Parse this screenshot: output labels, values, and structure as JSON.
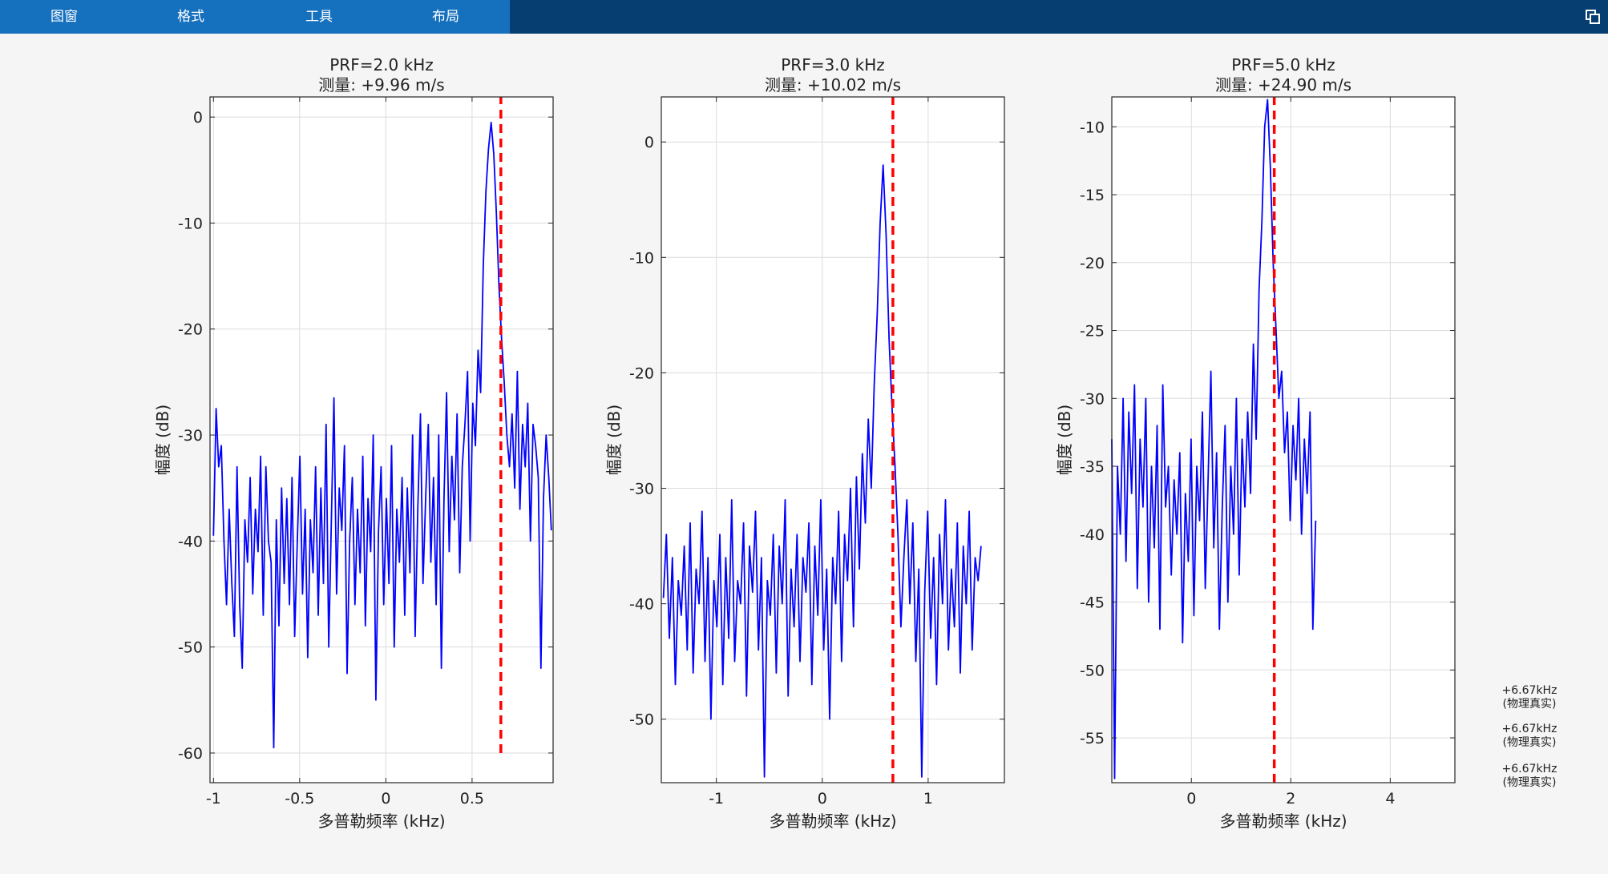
{
  "menu": {
    "tabs": [
      {
        "label": "图窗"
      },
      {
        "label": "格式"
      },
      {
        "label": "工具"
      },
      {
        "label": "布局"
      }
    ],
    "icon": "undock-icon"
  },
  "side_notes": [
    {
      "line1": "+6.67kHz",
      "line2": "(物理真实)"
    },
    {
      "line1": "+6.67kHz",
      "line2": "(物理真实)"
    },
    {
      "line1": "+6.67kHz",
      "line2": "(物理真实)"
    }
  ],
  "colors": {
    "spectrum": "#0000ff",
    "true_line": "#ff0000",
    "menubar": "#063e72",
    "tabbar": "#1570be"
  },
  "chart_data": [
    {
      "type": "line",
      "title_line1": "PRF=2.0 kHz",
      "title_line2": "测量:  +9.96 m/s",
      "xlabel": "多普勒频率 (kHz)",
      "ylabel": "幅度 (dB)",
      "xlim": [
        -1.02,
        0.97
      ],
      "ylim": [
        -62.8,
        1.9
      ],
      "xticks": [
        -1,
        -0.5,
        0,
        0.5
      ],
      "xtick_labels": [
        "-1",
        "-0.5",
        "0",
        "0.5"
      ],
      "yticks": [
        -60,
        -50,
        -40,
        -30,
        -20,
        -10,
        0
      ],
      "ytick_labels": [
        "-60",
        "-50",
        "-40",
        "-30",
        "-20",
        "-10",
        "0"
      ],
      "grid": true,
      "peak_x": 0.667,
      "x_start": -1.0,
      "x_end": 0.96,
      "vline": {
        "x": 0.667,
        "y_from": -60.0,
        "y_to": 1.9,
        "style": "dashed"
      },
      "series": [
        {
          "values": [
            -39.5,
            -27.5,
            -33,
            -31,
            -40,
            -46,
            -37,
            -44,
            -49,
            -33,
            -46,
            -52,
            -38,
            -42,
            -34,
            -45,
            -37,
            -41,
            -32,
            -47,
            -33,
            -40,
            -42,
            -59.5,
            -38,
            -48,
            -35,
            -44,
            -36,
            -46,
            -34,
            -49,
            -40,
            -32,
            -45,
            -37,
            -51,
            -38,
            -43,
            -33,
            -47,
            -35,
            -44,
            -29,
            -50,
            -38,
            -26.5,
            -45,
            -35,
            -39,
            -31,
            -52.5,
            -40,
            -34,
            -46,
            -37,
            -43,
            -32,
            -48,
            -36,
            -41,
            -30,
            -55,
            -39,
            -33,
            -46,
            -36,
            -44,
            -31,
            -50,
            -37,
            -42,
            -34,
            -47,
            -35,
            -43,
            -30,
            -49,
            -37,
            -28,
            -44,
            -36,
            -29,
            -42,
            -34,
            -46,
            -30,
            -52,
            -36,
            -26,
            -41,
            -32,
            -38,
            -28,
            -43,
            -33,
            -29,
            -24,
            -40,
            -27,
            -31,
            -22,
            -26,
            -14,
            -7,
            -3,
            -0.5,
            -3.5,
            -9,
            -16,
            -21,
            -25,
            -30,
            -33,
            -28,
            -35,
            -24,
            -37,
            -29,
            -33,
            -27,
            -40,
            -29,
            -31,
            -34,
            -52,
            -36,
            -30,
            -34,
            -39
          ]
        }
      ]
    },
    {
      "type": "line",
      "title_line1": "PRF=3.0 kHz",
      "title_line2": "测量: +10.02 m/s",
      "xlabel": "多普勒频率 (kHz)",
      "ylabel": "幅度 (dB)",
      "xlim": [
        -1.52,
        1.72
      ],
      "ylim": [
        -55.5,
        3.9
      ],
      "xticks": [
        -1,
        0,
        1
      ],
      "xtick_labels": [
        "-1",
        "0",
        "1"
      ],
      "yticks": [
        -50,
        -40,
        -30,
        -20,
        -10,
        0
      ],
      "ytick_labels": [
        "-50",
        "-40",
        "-30",
        "-20",
        "-10",
        "0"
      ],
      "grid": true,
      "peak_x": 0.667,
      "x_start": -1.5,
      "x_end": 1.5,
      "vline": {
        "x": 0.667,
        "y_from": -55.5,
        "y_to": 3.9,
        "style": "dashed"
      },
      "series": [
        {
          "values": [
            -39.5,
            -34,
            -43,
            -36,
            -47,
            -38,
            -41,
            -35,
            -44,
            -33,
            -46,
            -37,
            -40,
            -32,
            -45,
            -36,
            -50,
            -38,
            -42,
            -34,
            -47,
            -36,
            -43,
            -31,
            -45,
            -38,
            -40,
            -33,
            -48,
            -35,
            -39,
            -32,
            -44,
            -36,
            -55,
            -38,
            -41,
            -34,
            -46,
            -35,
            -40,
            -31,
            -48,
            -37,
            -42,
            -34,
            -45,
            -36,
            -39,
            -33,
            -47,
            -35,
            -41,
            -31,
            -44,
            -37,
            -50,
            -36,
            -40,
            -32,
            -45,
            -34,
            -38,
            -30,
            -42,
            -29,
            -37,
            -27,
            -33,
            -24,
            -30,
            -21,
            -15,
            -7,
            -2,
            -8,
            -17,
            -23,
            -28,
            -34,
            -42,
            -36,
            -31,
            -40,
            -33,
            -45,
            -37,
            -55,
            -39,
            -32,
            -43,
            -36,
            -47,
            -34,
            -40,
            -31,
            -44,
            -37,
            -42,
            -33,
            -46,
            -35,
            -40,
            -32,
            -44,
            -36,
            -38,
            -35
          ]
        }
      ]
    },
    {
      "type": "line",
      "title_line1": "PRF=5.0 kHz",
      "title_line2": "测量: +24.90 m/s",
      "xlabel": "多普勒频率 (kHz)",
      "ylabel": "幅度 (dB)",
      "xlim": [
        -1.6,
        5.3
      ],
      "ylim": [
        -58.3,
        -7.8
      ],
      "xticks": [
        0,
        2,
        4
      ],
      "xtick_labels": [
        "0",
        "2",
        "4"
      ],
      "yticks": [
        -55,
        -50,
        -45,
        -40,
        -35,
        -30,
        -25,
        -20,
        -15,
        -10
      ],
      "ytick_labels": [
        "-55",
        "-50",
        "-45",
        "-40",
        "-35",
        "-30",
        "-25",
        "-20",
        "-15",
        "-10"
      ],
      "grid": true,
      "peak_x": 1.667,
      "x_start": -1.6,
      "x_end": 2.5,
      "vline": {
        "x": 1.667,
        "y_from": -58.3,
        "y_to": -7.8,
        "style": "dashed"
      },
      "series": [
        {
          "values": [
            -33,
            -58,
            -35,
            -40,
            -30,
            -42,
            -31,
            -37,
            -29,
            -44,
            -33,
            -38,
            -30,
            -45,
            -35,
            -41,
            -32,
            -47,
            -29,
            -38,
            -35,
            -43,
            -36,
            -40,
            -34,
            -48,
            -37,
            -42,
            -33,
            -46,
            -35,
            -39,
            -31,
            -44,
            -36,
            -28,
            -41,
            -34,
            -47,
            -38,
            -32,
            -45,
            -35,
            -40,
            -30,
            -43,
            -33,
            -38,
            -31,
            -37,
            -26,
            -33,
            -22,
            -17,
            -10,
            -8,
            -13,
            -20,
            -25,
            -30,
            -28,
            -34,
            -31,
            -39,
            -32,
            -36,
            -30,
            -40,
            -33,
            -37,
            -31,
            -47,
            -39
          ]
        }
      ]
    }
  ]
}
